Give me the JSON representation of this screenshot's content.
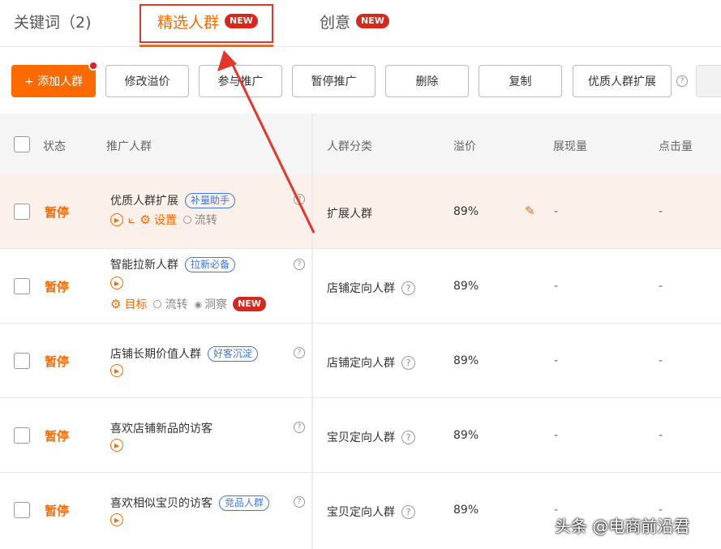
{
  "tabs": [
    {
      "label": "关键词（2)"
    },
    {
      "label": "精选人群",
      "badge": "NEW"
    },
    {
      "label": "创意",
      "badge": "NEW"
    }
  ],
  "toolbar": {
    "add_label": "+ 添加人群",
    "buttons": [
      "修改溢价",
      "参与推广",
      "暂停推广",
      "删除",
      "复制",
      "优质人群扩展"
    ],
    "help": "?"
  },
  "table": {
    "headers": [
      "状态",
      "推广人群",
      "人群分类",
      "溢价",
      "展现量",
      "点击量"
    ],
    "rows": [
      {
        "status": "暂停",
        "name": "优质人群扩展",
        "tag": "补量助手",
        "actions": [
          "设置"
        ],
        "extra": "流转",
        "category": "扩展人群",
        "premium": "89%",
        "impressions": "-",
        "clicks": "-"
      },
      {
        "status": "暂停",
        "name": "智能拉新人群",
        "tag": "拉新必备",
        "actions": [
          "目标"
        ],
        "extra": "流转",
        "extra2": "洞察",
        "badge": "NEW",
        "category": "店铺定向人群",
        "premium": "89%",
        "impressions": "-",
        "clicks": "-"
      },
      {
        "status": "暂停",
        "name": "店铺长期价值人群",
        "tag": "好客沉淀",
        "category": "店铺定向人群",
        "premium": "89%",
        "impressions": "-",
        "clicks": "-"
      },
      {
        "status": "暂停",
        "name": "喜欢店铺新品的访客",
        "category": "宝贝定向人群",
        "premium": "89%",
        "impressions": "-",
        "clicks": "-"
      },
      {
        "status": "暂停",
        "name": "喜欢相似宝贝的访客",
        "tag": "竞品人群",
        "category": "宝贝定向人群",
        "premium": "89%",
        "impressions": "-",
        "clicks": "-"
      }
    ]
  },
  "watermark": "头条 @电商前沿君",
  "colors": {
    "accent": "#ff6a00",
    "badge_red": "#d8281c",
    "tag_blue": "#3b78e7",
    "highlight_red": "#e5362a"
  }
}
